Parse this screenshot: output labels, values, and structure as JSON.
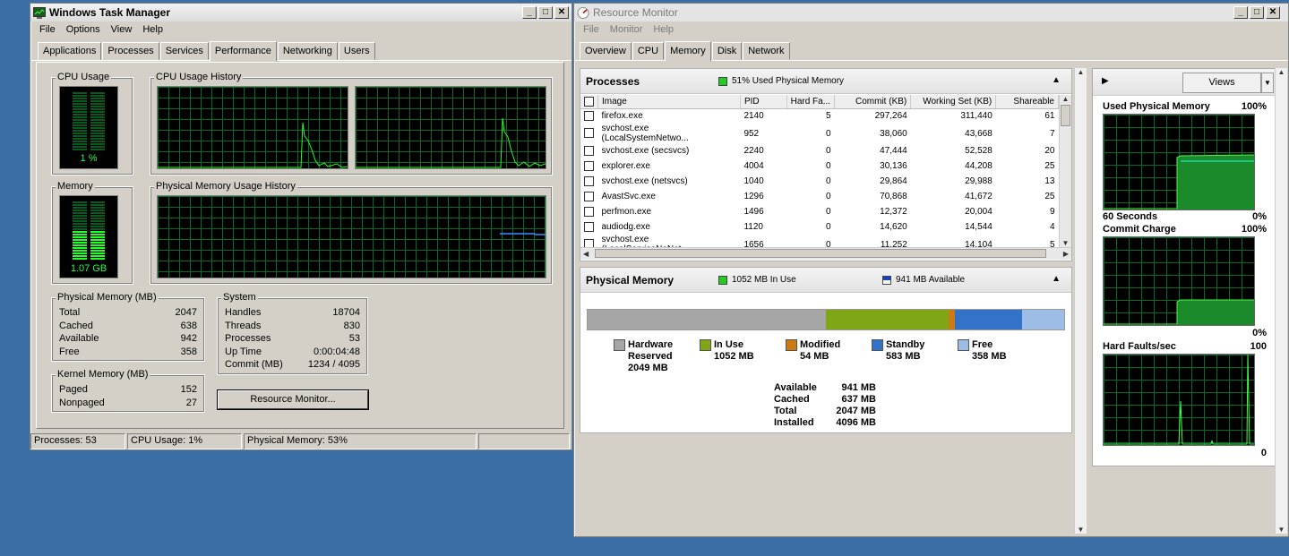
{
  "task_manager": {
    "title": "Windows Task Manager",
    "menu": [
      "File",
      "Options",
      "View",
      "Help"
    ],
    "tabs": [
      "Applications",
      "Processes",
      "Services",
      "Performance",
      "Networking",
      "Users"
    ],
    "active_tab": "Performance",
    "cpu_usage": {
      "label": "CPU Usage",
      "value": "1 %"
    },
    "cpu_history": {
      "label": "CPU Usage History"
    },
    "memory": {
      "label": "Memory",
      "value": "1.07 GB"
    },
    "mem_history": {
      "label": "Physical Memory Usage History"
    },
    "physical_memory": {
      "title": "Physical Memory (MB)",
      "rows": [
        [
          "Total",
          "2047"
        ],
        [
          "Cached",
          "638"
        ],
        [
          "Available",
          "942"
        ],
        [
          "Free",
          "358"
        ]
      ]
    },
    "system": {
      "title": "System",
      "rows": [
        [
          "Handles",
          "18704"
        ],
        [
          "Threads",
          "830"
        ],
        [
          "Processes",
          "53"
        ],
        [
          "Up Time",
          "0:00:04:48"
        ],
        [
          "Commit (MB)",
          "1234 / 4095"
        ]
      ]
    },
    "kernel_memory": {
      "title": "Kernel Memory (MB)",
      "rows": [
        [
          "Paged",
          "152"
        ],
        [
          "Nonpaged",
          "27"
        ]
      ]
    },
    "resource_monitor_button": "Resource Monitor...",
    "status": {
      "processes": "Processes: 53",
      "cpu": "CPU Usage: 1%",
      "memory": "Physical Memory: 53%"
    }
  },
  "resource_monitor": {
    "title": "Resource Monitor",
    "menu": [
      "File",
      "Monitor",
      "Help"
    ],
    "tabs": [
      "Overview",
      "CPU",
      "Memory",
      "Disk",
      "Network"
    ],
    "active_tab": "Memory",
    "processes": {
      "title": "Processes",
      "legend": "51% Used Physical Memory",
      "columns": [
        "Image",
        "PID",
        "Hard Fa...",
        "Commit (KB)",
        "Working Set (KB)",
        "Shareable"
      ],
      "rows": [
        [
          "firefox.exe",
          "2140",
          "5",
          "297,264",
          "311,440",
          "61"
        ],
        [
          "svchost.exe (LocalSystemNetwo...",
          "952",
          "0",
          "38,060",
          "43,668",
          "7"
        ],
        [
          "svchost.exe (secsvcs)",
          "2240",
          "0",
          "47,444",
          "52,528",
          "20"
        ],
        [
          "explorer.exe",
          "4004",
          "0",
          "30,136",
          "44,208",
          "25"
        ],
        [
          "svchost.exe (netsvcs)",
          "1040",
          "0",
          "29,864",
          "29,988",
          "13"
        ],
        [
          "AvastSvc.exe",
          "1296",
          "0",
          "70,868",
          "41,672",
          "25"
        ],
        [
          "perfmon.exe",
          "1496",
          "0",
          "12,372",
          "20,004",
          "9"
        ],
        [
          "audiodg.exe",
          "1120",
          "0",
          "14,620",
          "14,544",
          "4"
        ],
        [
          "svchost.exe (LocalServiceNoNet...",
          "1656",
          "0",
          "11,252",
          "14,104",
          "5"
        ]
      ]
    },
    "physical_memory": {
      "title": "Physical Memory",
      "in_use_legend": "1052 MB In Use",
      "available_legend": "941 MB Available",
      "bar": [
        {
          "name": "Hardware Reserved",
          "mb": 2049,
          "color": "#a6a6a6"
        },
        {
          "name": "In Use",
          "mb": 1052,
          "color": "#7ea617"
        },
        {
          "name": "Modified",
          "mb": 54,
          "color": "#cc7a14"
        },
        {
          "name": "Standby",
          "mb": 583,
          "color": "#3272c8"
        },
        {
          "name": "Free",
          "mb": 358,
          "color": "#9dbde6"
        }
      ],
      "legend": [
        {
          "l1": "Hardware",
          "l2": "Reserved",
          "l3": "2049 MB",
          "color": "#a6a6a6"
        },
        {
          "l1": "In Use",
          "l2": "1052 MB",
          "l3": "",
          "color": "#7ea617"
        },
        {
          "l1": "Modified",
          "l2": "54 MB",
          "l3": "",
          "color": "#cc7a14"
        },
        {
          "l1": "Standby",
          "l2": "583 MB",
          "l3": "",
          "color": "#3272c8"
        },
        {
          "l1": "Free",
          "l2": "358 MB",
          "l3": "",
          "color": "#9dbde6"
        }
      ],
      "summary": [
        [
          "Available",
          "941 MB"
        ],
        [
          "Cached",
          "637 MB"
        ],
        [
          "Total",
          "2047 MB"
        ],
        [
          "Installed",
          "4096 MB"
        ]
      ]
    },
    "side": {
      "views_label": "Views",
      "graphs": [
        {
          "title": "Used Physical Memory",
          "max": "100%",
          "foot_left": "60 Seconds",
          "foot_right": "0%"
        },
        {
          "title": "Commit Charge",
          "max": "100%",
          "foot_left": "",
          "foot_right": "0%"
        },
        {
          "title": "Hard Faults/sec",
          "max": "100",
          "foot_left": "",
          "foot_right": "0"
        }
      ]
    }
  }
}
